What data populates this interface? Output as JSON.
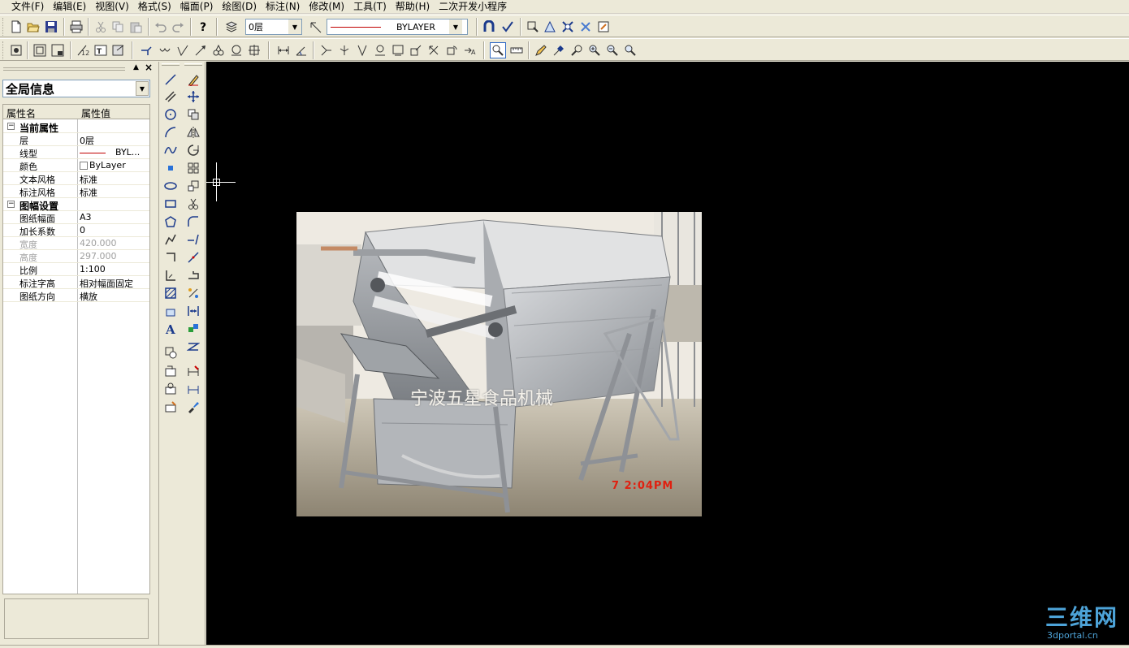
{
  "menu": [
    "文件(F)",
    "编辑(E)",
    "视图(V)",
    "格式(S)",
    "幅面(P)",
    "绘图(D)",
    "标注(N)",
    "修改(M)",
    "工具(T)",
    "帮助(H)",
    "二次开发小程序"
  ],
  "toolbar": {
    "layer_value": "0层",
    "linetype_value": "BYLAYER"
  },
  "panel": {
    "scope_value": "全局信息",
    "col_name": "属性名",
    "col_value": "属性值",
    "rows": [
      {
        "cat": "当前属性"
      },
      {
        "name": "层",
        "value": "0层"
      },
      {
        "name": "线型",
        "value": "BYL..."
      },
      {
        "name": "颜色",
        "value": "ByLayer"
      },
      {
        "name": "文本风格",
        "value": "标准"
      },
      {
        "name": "标注风格",
        "value": "标准"
      },
      {
        "cat": "图幅设置"
      },
      {
        "name": "图纸幅面",
        "value": "A3"
      },
      {
        "name": "加长系数",
        "value": "0"
      },
      {
        "name": "宽度",
        "value": "420.000"
      },
      {
        "name": "高度",
        "value": "297.000"
      },
      {
        "name": "比例",
        "value": "1:100"
      },
      {
        "name": "标注字高",
        "value": "相对幅面固定"
      },
      {
        "name": "图纸方向",
        "value": "横放"
      }
    ],
    "cat_toggle": "−"
  },
  "canvas": {
    "raster_caption": "宁波五星食品机械",
    "raster_date": "7  2:04PM"
  },
  "watermark": {
    "main": "三维网",
    "sub": "3dportal.cn"
  },
  "colors": {
    "linetype_sample": "#c00000",
    "watermark": "#4da3d8",
    "canvas_bg": "#000000"
  }
}
